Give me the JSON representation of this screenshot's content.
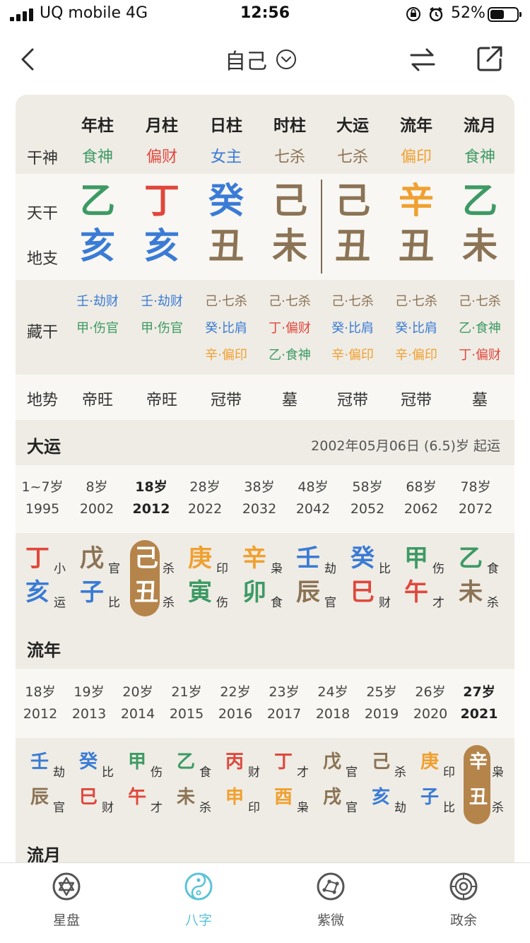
{
  "colors": {
    "green": "#3d9a64",
    "red": "#e0473c",
    "blue": "#3a7bd5",
    "brown": "#8b7355",
    "orange": "#f0a030",
    "accent": "#5cc3d8",
    "selected_bg": "#b5844a"
  },
  "status_bar": {
    "carrier": "UQ mobile   4G",
    "time": "12:56",
    "battery": "52%",
    "battery_level": 0.52
  },
  "nav": {
    "title": "自己",
    "back_icon": "chevron-left-icon",
    "dropdown_icon": "chevron-down-circle-icon",
    "swap_icon": "swap-arrows-icon",
    "share_icon": "share-icon"
  },
  "chart": {
    "headers": [
      "年柱",
      "月柱",
      "日柱",
      "时柱",
      "大运",
      "流年",
      "流月"
    ],
    "row_labels": {
      "shishen": "干神",
      "tiangan": "天干",
      "dizhi": "地支",
      "canggan": "藏干",
      "dishi": "地势"
    },
    "shishen": [
      {
        "t": "食神",
        "c": "green"
      },
      {
        "t": "偏财",
        "c": "red"
      },
      {
        "t": "女主",
        "c": "blue"
      },
      {
        "t": "七杀",
        "c": "brown"
      },
      {
        "t": "七杀",
        "c": "brown"
      },
      {
        "t": "偏印",
        "c": "orange"
      },
      {
        "t": "食神",
        "c": "green"
      }
    ],
    "tiangan": [
      {
        "t": "乙",
        "c": "green"
      },
      {
        "t": "丁",
        "c": "red"
      },
      {
        "t": "癸",
        "c": "blue"
      },
      {
        "t": "己",
        "c": "brown"
      },
      {
        "t": "己",
        "c": "brown"
      },
      {
        "t": "辛",
        "c": "orange"
      },
      {
        "t": "乙",
        "c": "green"
      }
    ],
    "dizhi": [
      {
        "t": "亥",
        "c": "blue"
      },
      {
        "t": "亥",
        "c": "blue"
      },
      {
        "t": "丑",
        "c": "brown"
      },
      {
        "t": "未",
        "c": "brown"
      },
      {
        "t": "丑",
        "c": "brown"
      },
      {
        "t": "丑",
        "c": "brown"
      },
      {
        "t": "未",
        "c": "brown"
      }
    ],
    "canggan": [
      [
        {
          "t": "壬·劫财",
          "c": "blue"
        },
        {
          "t": "甲·伤官",
          "c": "green"
        }
      ],
      [
        {
          "t": "壬·劫财",
          "c": "blue"
        },
        {
          "t": "甲·伤官",
          "c": "green"
        }
      ],
      [
        {
          "t": "己·七杀",
          "c": "brown"
        },
        {
          "t": "癸·比肩",
          "c": "blue"
        },
        {
          "t": "辛·偏印",
          "c": "orange"
        }
      ],
      [
        {
          "t": "己·七杀",
          "c": "brown"
        },
        {
          "t": "丁·偏财",
          "c": "red"
        },
        {
          "t": "乙·食神",
          "c": "green"
        }
      ],
      [
        {
          "t": "己·七杀",
          "c": "brown"
        },
        {
          "t": "癸·比肩",
          "c": "blue"
        },
        {
          "t": "辛·偏印",
          "c": "orange"
        }
      ],
      [
        {
          "t": "己·七杀",
          "c": "brown"
        },
        {
          "t": "癸·比肩",
          "c": "blue"
        },
        {
          "t": "辛·偏印",
          "c": "orange"
        }
      ],
      [
        {
          "t": "己·七杀",
          "c": "brown"
        },
        {
          "t": "乙·食神",
          "c": "green"
        },
        {
          "t": "丁·偏财",
          "c": "red"
        }
      ]
    ],
    "dishi": [
      "帝旺",
      "帝旺",
      "冠带",
      "墓",
      "冠带",
      "冠带",
      "墓"
    ]
  },
  "dayun": {
    "title": "大运",
    "start_info": "2002年05月06日 (6.5)岁 起运",
    "ages": [
      "1~7岁",
      "8岁",
      "18岁",
      "28岁",
      "38岁",
      "48岁",
      "58岁",
      "68岁",
      "78岁"
    ],
    "years": [
      "1995",
      "2002",
      "2012",
      "2022",
      "2032",
      "2042",
      "2052",
      "2062",
      "2072"
    ],
    "selected_index": 2,
    "pillars": [
      {
        "g": "丁",
        "gc": "red",
        "gs": "小",
        "z": "亥",
        "zc": "blue",
        "zs": "运"
      },
      {
        "g": "戊",
        "gc": "brown",
        "gs": "官",
        "z": "子",
        "zc": "blue",
        "zs": "比"
      },
      {
        "g": "己",
        "gc": "brown",
        "gs": "杀",
        "z": "丑",
        "zc": "brown",
        "zs": "杀"
      },
      {
        "g": "庚",
        "gc": "orange",
        "gs": "印",
        "z": "寅",
        "zc": "green",
        "zs": "伤"
      },
      {
        "g": "辛",
        "gc": "orange",
        "gs": "枭",
        "z": "卯",
        "zc": "green",
        "zs": "食"
      },
      {
        "g": "壬",
        "gc": "blue",
        "gs": "劫",
        "z": "辰",
        "zc": "brown",
        "zs": "官"
      },
      {
        "g": "癸",
        "gc": "blue",
        "gs": "比",
        "z": "巳",
        "zc": "red",
        "zs": "财"
      },
      {
        "g": "甲",
        "gc": "green",
        "gs": "伤",
        "z": "午",
        "zc": "red",
        "zs": "才"
      },
      {
        "g": "乙",
        "gc": "green",
        "gs": "食",
        "z": "未",
        "zc": "brown",
        "zs": "杀"
      }
    ]
  },
  "liunian": {
    "title": "流年",
    "ages": [
      "18岁",
      "19岁",
      "20岁",
      "21岁",
      "22岁",
      "23岁",
      "24岁",
      "25岁",
      "26岁",
      "27岁"
    ],
    "years": [
      "2012",
      "2013",
      "2014",
      "2015",
      "2016",
      "2017",
      "2018",
      "2019",
      "2020",
      "2021"
    ],
    "selected_index": 9,
    "pillars": [
      {
        "g": "壬",
        "gc": "blue",
        "gs": "劫",
        "z": "辰",
        "zc": "brown",
        "zs": "官"
      },
      {
        "g": "癸",
        "gc": "blue",
        "gs": "比",
        "z": "巳",
        "zc": "red",
        "zs": "财"
      },
      {
        "g": "甲",
        "gc": "green",
        "gs": "伤",
        "z": "午",
        "zc": "red",
        "zs": "才"
      },
      {
        "g": "乙",
        "gc": "green",
        "gs": "食",
        "z": "未",
        "zc": "brown",
        "zs": "杀"
      },
      {
        "g": "丙",
        "gc": "red",
        "gs": "财",
        "z": "申",
        "zc": "orange",
        "zs": "印"
      },
      {
        "g": "丁",
        "gc": "red",
        "gs": "才",
        "z": "酉",
        "zc": "orange",
        "zs": "枭"
      },
      {
        "g": "戊",
        "gc": "brown",
        "gs": "官",
        "z": "戌",
        "zc": "brown",
        "zs": "官"
      },
      {
        "g": "己",
        "gc": "brown",
        "gs": "杀",
        "z": "亥",
        "zc": "blue",
        "zs": "劫"
      },
      {
        "g": "庚",
        "gc": "orange",
        "gs": "印",
        "z": "子",
        "zc": "blue",
        "zs": "比"
      },
      {
        "g": "辛",
        "gc": "orange",
        "gs": "枭",
        "z": "丑",
        "zc": "brown",
        "zs": "杀"
      }
    ]
  },
  "liuyue": {
    "title": "流月"
  },
  "tabbar": {
    "items": [
      {
        "label": "星盘",
        "icon": "hexagram-icon"
      },
      {
        "label": "八字",
        "icon": "yin-yang-icon"
      },
      {
        "label": "紫微",
        "icon": "constellation-icon"
      },
      {
        "label": "政余",
        "icon": "target-circle-icon"
      }
    ],
    "active_index": 1
  }
}
